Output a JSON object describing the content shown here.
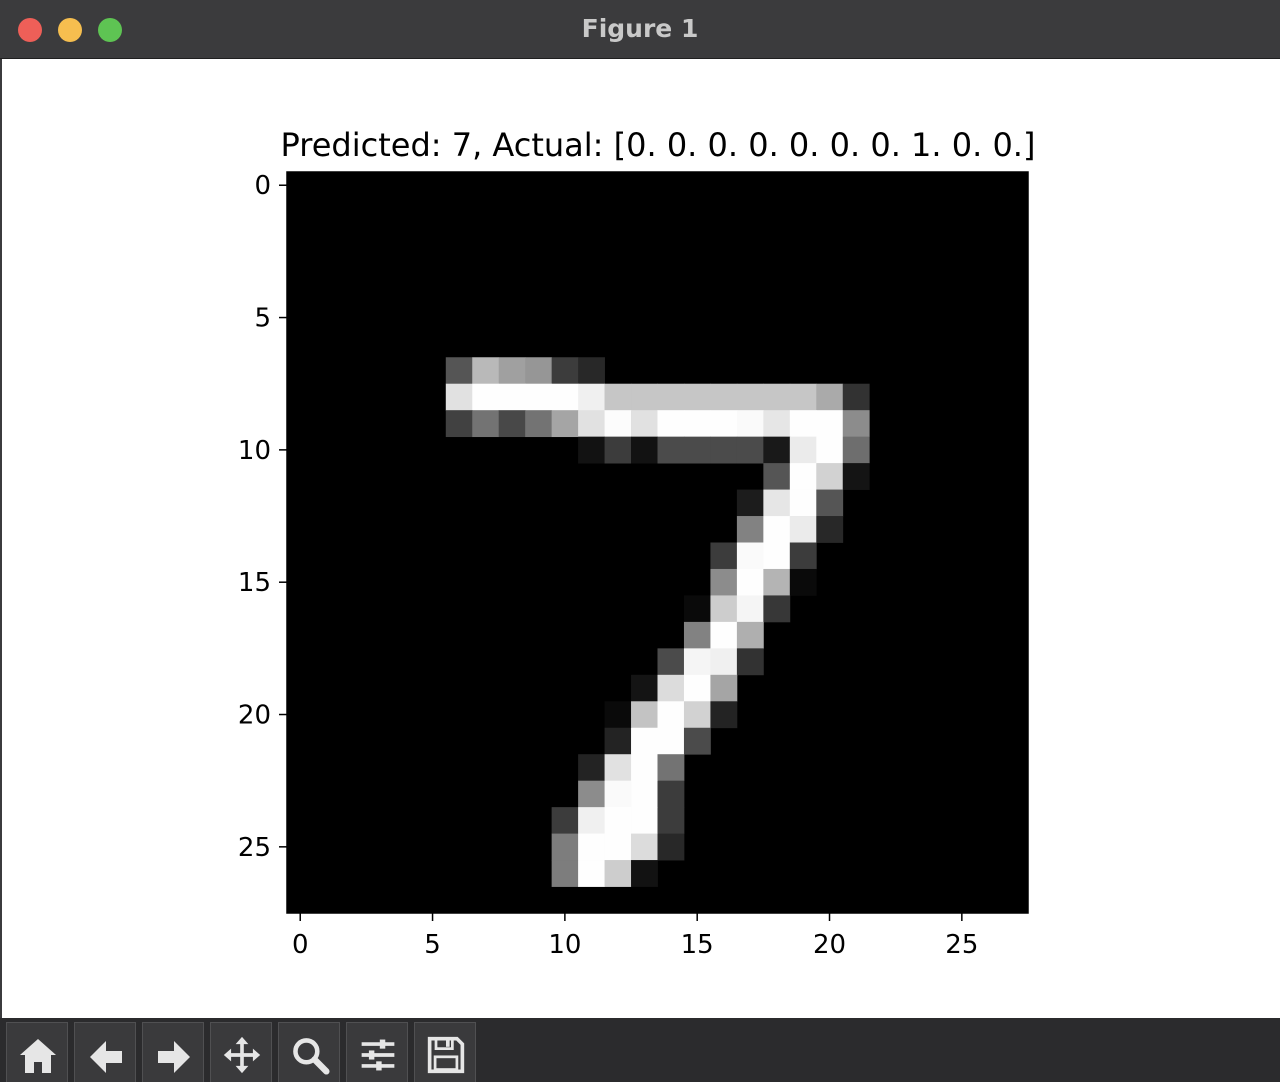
{
  "window": {
    "title": "Figure 1"
  },
  "chart_data": {
    "type": "heatmap",
    "title": "Predicted: 7, Actual: [0. 0. 0. 0. 0. 0. 0. 1. 0. 0.]",
    "colormap": "gray",
    "xlim": [
      -0.5,
      27.5
    ],
    "ylim": [
      27.5,
      -0.5
    ],
    "xticks": [
      "0",
      "5",
      "10",
      "15",
      "20",
      "25"
    ],
    "yticks": [
      "0",
      "5",
      "10",
      "15",
      "20",
      "25"
    ],
    "nonzero_pixels": [
      [
        7,
        6,
        85
      ],
      [
        7,
        7,
        185
      ],
      [
        7,
        8,
        160
      ],
      [
        7,
        9,
        150
      ],
      [
        7,
        10,
        60
      ],
      [
        7,
        11,
        40
      ],
      [
        8,
        6,
        225
      ],
      [
        8,
        7,
        254
      ],
      [
        8,
        8,
        254
      ],
      [
        8,
        9,
        254
      ],
      [
        8,
        10,
        254
      ],
      [
        8,
        11,
        240
      ],
      [
        8,
        12,
        198
      ],
      [
        8,
        13,
        198
      ],
      [
        8,
        14,
        198
      ],
      [
        8,
        15,
        198
      ],
      [
        8,
        16,
        198
      ],
      [
        8,
        17,
        198
      ],
      [
        8,
        18,
        198
      ],
      [
        8,
        19,
        198
      ],
      [
        8,
        20,
        170
      ],
      [
        8,
        21,
        50
      ],
      [
        9,
        6,
        65
      ],
      [
        9,
        7,
        115
      ],
      [
        9,
        8,
        72
      ],
      [
        9,
        9,
        115
      ],
      [
        9,
        10,
        165
      ],
      [
        9,
        11,
        225
      ],
      [
        9,
        12,
        252
      ],
      [
        9,
        13,
        225
      ],
      [
        9,
        14,
        254
      ],
      [
        9,
        15,
        254
      ],
      [
        9,
        16,
        254
      ],
      [
        9,
        17,
        250
      ],
      [
        9,
        18,
        230
      ],
      [
        9,
        19,
        254
      ],
      [
        9,
        20,
        254
      ],
      [
        9,
        21,
        140
      ],
      [
        10,
        11,
        18
      ],
      [
        10,
        12,
        60
      ],
      [
        10,
        13,
        18
      ],
      [
        10,
        14,
        75
      ],
      [
        10,
        15,
        75
      ],
      [
        10,
        16,
        75
      ],
      [
        10,
        17,
        75
      ],
      [
        10,
        18,
        25
      ],
      [
        10,
        19,
        235
      ],
      [
        10,
        20,
        254
      ],
      [
        10,
        21,
        110
      ],
      [
        11,
        18,
        85
      ],
      [
        11,
        19,
        254
      ],
      [
        11,
        20,
        210
      ],
      [
        11,
        21,
        20
      ],
      [
        12,
        17,
        28
      ],
      [
        12,
        18,
        230
      ],
      [
        12,
        19,
        254
      ],
      [
        12,
        20,
        85
      ],
      [
        13,
        17,
        130
      ],
      [
        13,
        18,
        254
      ],
      [
        13,
        19,
        235
      ],
      [
        13,
        20,
        40
      ],
      [
        14,
        16,
        60
      ],
      [
        14,
        17,
        250
      ],
      [
        14,
        18,
        254
      ],
      [
        14,
        19,
        60
      ],
      [
        15,
        16,
        140
      ],
      [
        15,
        17,
        254
      ],
      [
        15,
        18,
        180
      ],
      [
        15,
        19,
        10
      ],
      [
        16,
        15,
        10
      ],
      [
        16,
        16,
        205
      ],
      [
        16,
        17,
        245
      ],
      [
        16,
        18,
        55
      ],
      [
        17,
        15,
        130
      ],
      [
        17,
        16,
        254
      ],
      [
        17,
        17,
        175
      ],
      [
        18,
        14,
        75
      ],
      [
        18,
        15,
        245
      ],
      [
        18,
        16,
        240
      ],
      [
        18,
        17,
        50
      ],
      [
        19,
        13,
        20
      ],
      [
        19,
        14,
        220
      ],
      [
        19,
        15,
        254
      ],
      [
        19,
        16,
        165
      ],
      [
        20,
        12,
        10
      ],
      [
        20,
        13,
        195
      ],
      [
        20,
        14,
        254
      ],
      [
        20,
        15,
        210
      ],
      [
        20,
        16,
        35
      ],
      [
        21,
        12,
        35
      ],
      [
        21,
        13,
        254
      ],
      [
        21,
        14,
        254
      ],
      [
        21,
        15,
        75
      ],
      [
        22,
        11,
        35
      ],
      [
        22,
        12,
        225
      ],
      [
        22,
        13,
        254
      ],
      [
        22,
        14,
        115
      ],
      [
        23,
        11,
        140
      ],
      [
        23,
        12,
        250
      ],
      [
        23,
        13,
        254
      ],
      [
        23,
        14,
        60
      ],
      [
        24,
        10,
        60
      ],
      [
        24,
        11,
        240
      ],
      [
        24,
        12,
        254
      ],
      [
        24,
        13,
        254
      ],
      [
        24,
        14,
        60
      ],
      [
        25,
        10,
        125
      ],
      [
        25,
        11,
        254
      ],
      [
        25,
        12,
        254
      ],
      [
        25,
        13,
        220
      ],
      [
        25,
        14,
        40
      ],
      [
        26,
        10,
        125
      ],
      [
        26,
        11,
        254
      ],
      [
        26,
        12,
        205
      ],
      [
        26,
        13,
        18
      ]
    ]
  },
  "toolbar": {
    "buttons": [
      "home-icon",
      "back-arrow-icon",
      "forward-arrow-icon",
      "pan-move-icon",
      "zoom-magnifier-icon",
      "configure-subplots-icon",
      "save-floppy-icon"
    ]
  }
}
